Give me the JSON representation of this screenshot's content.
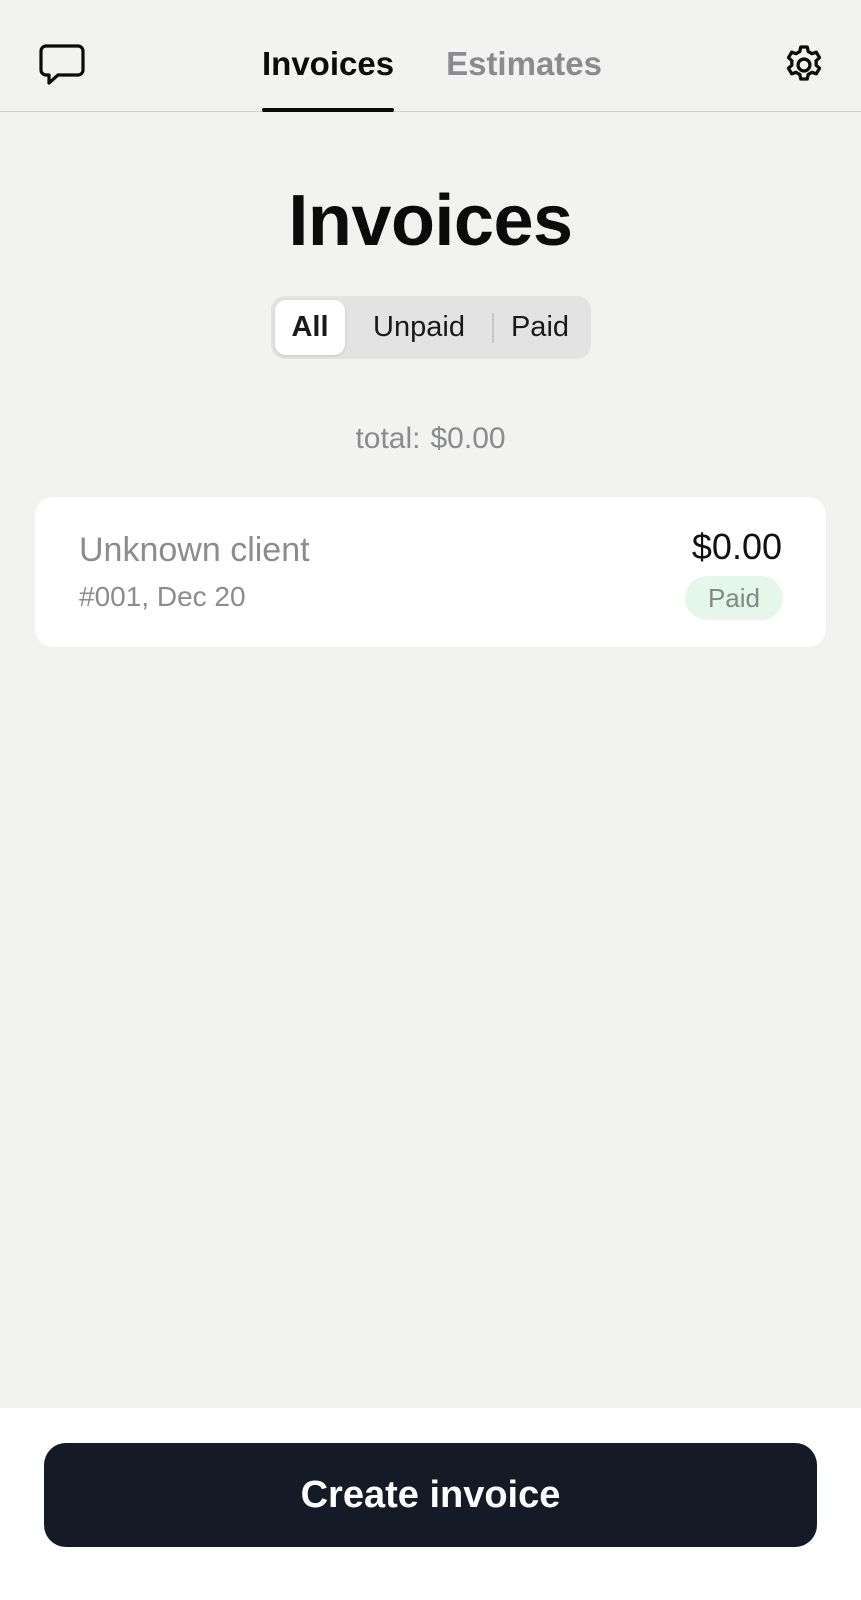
{
  "nav": {
    "tabs": [
      {
        "label": "Invoices",
        "active": true
      },
      {
        "label": "Estimates",
        "active": false
      }
    ],
    "left_icon": "chat-bubble-icon",
    "right_icon": "gear-icon"
  },
  "page": {
    "title": "Invoices"
  },
  "filter": {
    "options": [
      {
        "label": "All",
        "active": true
      },
      {
        "label": "Unpaid",
        "active": false
      },
      {
        "label": "Paid",
        "active": false
      }
    ]
  },
  "summary": {
    "total_label": "total:",
    "total_value": "$0.00"
  },
  "invoices": [
    {
      "client": "Unknown client",
      "meta": "#001, Dec 20",
      "amount": "$0.00",
      "status": "Paid"
    }
  ],
  "footer": {
    "create_label": "Create invoice"
  },
  "colors": {
    "background": "#f2f2f1",
    "primary_button": "#141b27",
    "paid_badge_bg": "#e5f7e9",
    "muted_text": "#8a8b8e"
  }
}
